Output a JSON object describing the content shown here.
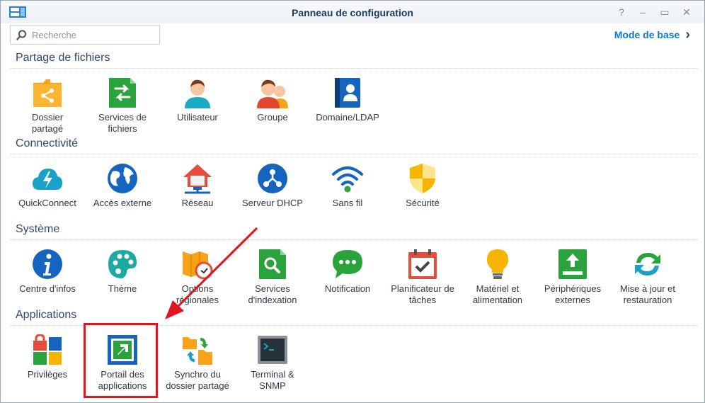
{
  "window": {
    "title": "Panneau de configuration"
  },
  "controls": {
    "help": "?",
    "minimize": "–",
    "maximize": "▭",
    "close": "✕"
  },
  "search": {
    "placeholder": "Recherche",
    "value": ""
  },
  "mode_link": {
    "label": "Mode de base",
    "chevron": "›"
  },
  "sections": {
    "partage": {
      "title": "Partage de fichiers",
      "items": [
        {
          "label_1": "Dossier",
          "label_2": "partagé",
          "icon": "shared-folder-icon"
        },
        {
          "label_1": "Services de",
          "label_2": "fichiers",
          "icon": "file-services-icon"
        },
        {
          "label_1": "Utilisateur",
          "label_2": "",
          "icon": "user-icon"
        },
        {
          "label_1": "Groupe",
          "label_2": "",
          "icon": "group-icon"
        },
        {
          "label_1": "Domaine/LDAP",
          "label_2": "",
          "icon": "domain-ldap-icon"
        }
      ]
    },
    "connectivite": {
      "title": "Connectivité",
      "items": [
        {
          "label_1": "QuickConnect",
          "label_2": "",
          "icon": "quickconnect-icon"
        },
        {
          "label_1": "Accès externe",
          "label_2": "",
          "icon": "external-access-icon"
        },
        {
          "label_1": "Réseau",
          "label_2": "",
          "icon": "network-icon"
        },
        {
          "label_1": "Serveur DHCP",
          "label_2": "",
          "icon": "dhcp-server-icon"
        },
        {
          "label_1": "Sans fil",
          "label_2": "",
          "icon": "wireless-icon"
        },
        {
          "label_1": "Sécurité",
          "label_2": "",
          "icon": "security-shield-icon"
        }
      ]
    },
    "systeme": {
      "title": "Système",
      "items": [
        {
          "label_1": "Centre d'infos",
          "label_2": "",
          "icon": "info-center-icon"
        },
        {
          "label_1": "Thème",
          "label_2": "",
          "icon": "theme-palette-icon"
        },
        {
          "label_1": "Options",
          "label_2": "régionales",
          "icon": "regional-options-icon"
        },
        {
          "label_1": "Services",
          "label_2": "d'indexation",
          "icon": "indexing-service-icon"
        },
        {
          "label_1": "Notification",
          "label_2": "",
          "icon": "notification-icon"
        },
        {
          "label_1": "Planificateur de",
          "label_2": "tâches",
          "icon": "task-scheduler-icon"
        },
        {
          "label_1": "Matériel et",
          "label_2": "alimentation",
          "icon": "hardware-power-icon"
        },
        {
          "label_1": "Périphériques",
          "label_2": "externes",
          "icon": "external-devices-icon"
        },
        {
          "label_1": "Mise à jour et",
          "label_2": "restauration",
          "icon": "update-restore-icon"
        }
      ]
    },
    "applications": {
      "title": "Applications",
      "items": [
        {
          "label_1": "Privilèges",
          "label_2": "",
          "icon": "privileges-icon"
        },
        {
          "label_1": "Portail des",
          "label_2": "applications",
          "icon": "application-portal-icon"
        },
        {
          "label_1": "Synchro du",
          "label_2": "dossier partagé",
          "icon": "shared-folder-sync-icon"
        },
        {
          "label_1": "Terminal &",
          "label_2": "SNMP",
          "icon": "terminal-snmp-icon"
        }
      ]
    }
  },
  "colors": {
    "accent": "#0d79c8",
    "highlight": "#e0151f",
    "section_title": "#2f4a66"
  }
}
